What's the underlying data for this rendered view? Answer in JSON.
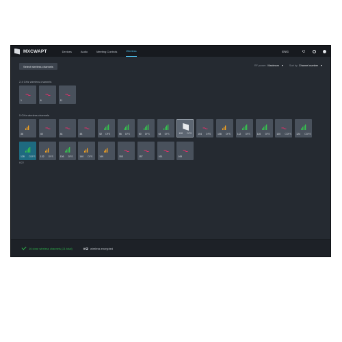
{
  "app": {
    "name": "MXCWAPT",
    "nav": [
      "Devices",
      "Audio",
      "Meeting Controls",
      "Wireless"
    ],
    "active_nav": 3,
    "language": "ENG",
    "icons": [
      "gear-icon",
      "help-icon",
      "user-icon"
    ]
  },
  "toolbar": {
    "select_button": "Select wireless channels",
    "rf_power_label": "RF power:",
    "rf_power_value": "Maximum",
    "sort_label": "Sort by",
    "sort_value": "Channel number"
  },
  "colors": {
    "green": "#35c24e",
    "orange": "#f0a020",
    "red": "#e0306a",
    "accent": "#4ec3f0"
  },
  "section_24": {
    "title": "2.4 GHz wireless channels",
    "channels": [
      {
        "num": "1",
        "tag": "",
        "signal": "red",
        "state": "normal"
      },
      {
        "num": "6",
        "tag": "",
        "signal": "red",
        "state": "normal"
      },
      {
        "num": "11",
        "tag": "",
        "signal": "red",
        "state": "normal"
      }
    ]
  },
  "section_5": {
    "title": "5 GHz wireless channels",
    "channels": [
      {
        "num": "36",
        "tag": "",
        "signal": "orange",
        "state": "normal"
      },
      {
        "num": "40",
        "tag": "",
        "signal": "red",
        "state": "normal"
      },
      {
        "num": "44",
        "tag": "",
        "signal": "red",
        "state": "normal"
      },
      {
        "num": "48",
        "tag": "",
        "signal": "red",
        "state": "normal"
      },
      {
        "num": "52",
        "tag": "DFS",
        "signal": "green",
        "state": "normal"
      },
      {
        "num": "56",
        "tag": "DFS",
        "signal": "green",
        "state": "normal"
      },
      {
        "num": "60",
        "tag": "DFS",
        "signal": "green",
        "state": "normal"
      },
      {
        "num": "64",
        "tag": "DFS",
        "signal": "green",
        "state": "normal"
      },
      {
        "num": "100",
        "tag": "DFS",
        "signal": "device",
        "state": "selected"
      },
      {
        "num": "104",
        "tag": "DFS",
        "signal": "red",
        "state": "normal"
      },
      {
        "num": "108",
        "tag": "DFS",
        "signal": "orange",
        "state": "normal"
      },
      {
        "num": "112",
        "tag": "DFS",
        "signal": "green",
        "state": "normal"
      },
      {
        "num": "116",
        "tag": "DFS",
        "signal": "green",
        "state": "normal"
      },
      {
        "num": "120",
        "tag": "CDFS",
        "signal": "red",
        "state": "normal"
      },
      {
        "num": "124",
        "tag": "CDFS",
        "signal": "green",
        "state": "normal"
      },
      {
        "num": "128",
        "tag": "CDFS",
        "signal": "green",
        "state": "hilite",
        "below": "6/22"
      },
      {
        "num": "132",
        "tag": "DFS",
        "signal": "orange",
        "state": "normal"
      },
      {
        "num": "136",
        "tag": "DFS",
        "signal": "green",
        "state": "normal"
      },
      {
        "num": "140",
        "tag": "DFS",
        "signal": "orange",
        "state": "normal"
      },
      {
        "num": "149",
        "tag": "",
        "signal": "orange",
        "state": "normal"
      },
      {
        "num": "153",
        "tag": "",
        "signal": "red",
        "state": "normal"
      },
      {
        "num": "157",
        "tag": "",
        "signal": "red",
        "state": "normal"
      },
      {
        "num": "161",
        "tag": "",
        "signal": "red",
        "state": "normal"
      },
      {
        "num": "165",
        "tag": "",
        "signal": "red",
        "state": "normal"
      }
    ]
  },
  "footer": {
    "status": "16 clear wireless channels (21 total)",
    "enc_number": "0",
    "enc_text": "wireless encrypted"
  }
}
